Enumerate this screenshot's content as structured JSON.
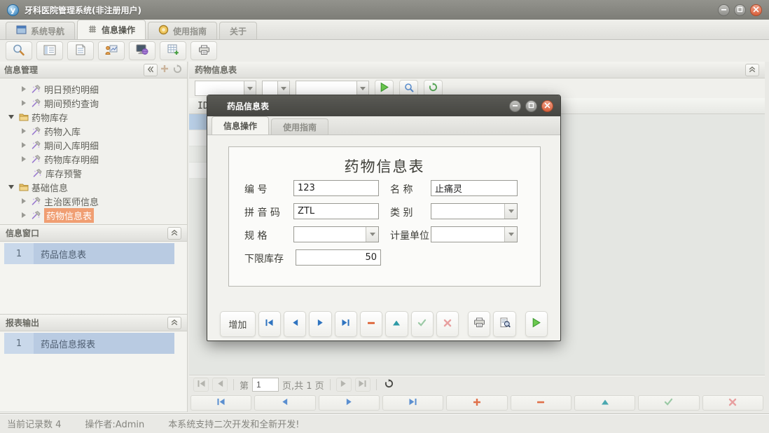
{
  "titlebar": {
    "logo": "y",
    "title": "牙科医院管理系统(非注册用户)"
  },
  "tabs": [
    {
      "label": "系统导航"
    },
    {
      "label": "信息操作"
    },
    {
      "label": "使用指南"
    },
    {
      "label": "关于"
    }
  ],
  "sidebar": {
    "header": "信息管理",
    "tree": [
      {
        "label": "明日预约明细"
      },
      {
        "label": "期间预约查询"
      },
      {
        "label": "药物库存"
      },
      {
        "label": "药物入库"
      },
      {
        "label": "期间入库明细"
      },
      {
        "label": "药物库存明细"
      },
      {
        "label": "库存预警"
      },
      {
        "label": "基础信息"
      },
      {
        "label": "主治医师信息"
      },
      {
        "label": "药物信息表"
      }
    ],
    "info_window": {
      "header": "信息窗口",
      "row_num": "1",
      "row_label": "药品信息表"
    },
    "report_output": {
      "header": "报表输出",
      "row_num": "1",
      "row_label": "药品信息报表"
    }
  },
  "main": {
    "panel_header": "药物信息表",
    "grid_id_header": "ID",
    "filter": {
      "combo1": "",
      "combo2": "",
      "combo3": ""
    },
    "pager": {
      "prefix": "第",
      "page": "1",
      "suffix": "页,共 1 页"
    }
  },
  "dialog": {
    "title": "药品信息表",
    "tabs": [
      {
        "label": "信息操作"
      },
      {
        "label": "使用指南"
      }
    ],
    "heading": "药物信息表",
    "fields": {
      "code": {
        "label": "编  号",
        "value": "123"
      },
      "name": {
        "label": "名  称",
        "value": "止痛灵"
      },
      "pinyin": {
        "label": "拼 音 码",
        "value": "ZTL"
      },
      "category": {
        "label": "类  别",
        "value": ""
      },
      "spec": {
        "label": "规  格",
        "value": ""
      },
      "unit": {
        "label": "计量单位",
        "value": ""
      },
      "min_stock": {
        "label": "下限库存",
        "value": "50"
      }
    },
    "add_button": "增加"
  },
  "statusbar": {
    "record_count": "当前记录数 4",
    "operator": "操作者:Admin",
    "message": "本系统支持二次开发和全新开发!"
  },
  "colors": {
    "selection_orange": "#f09e72",
    "selection_blue": "#b9cbe2",
    "accent_green": "#58b14b",
    "accent_blue": "#2f74c0",
    "accent_orange": "#dc5a2a",
    "accent_teal": "#2e9aa6",
    "dialog_titlebar": "#4b4b46"
  }
}
